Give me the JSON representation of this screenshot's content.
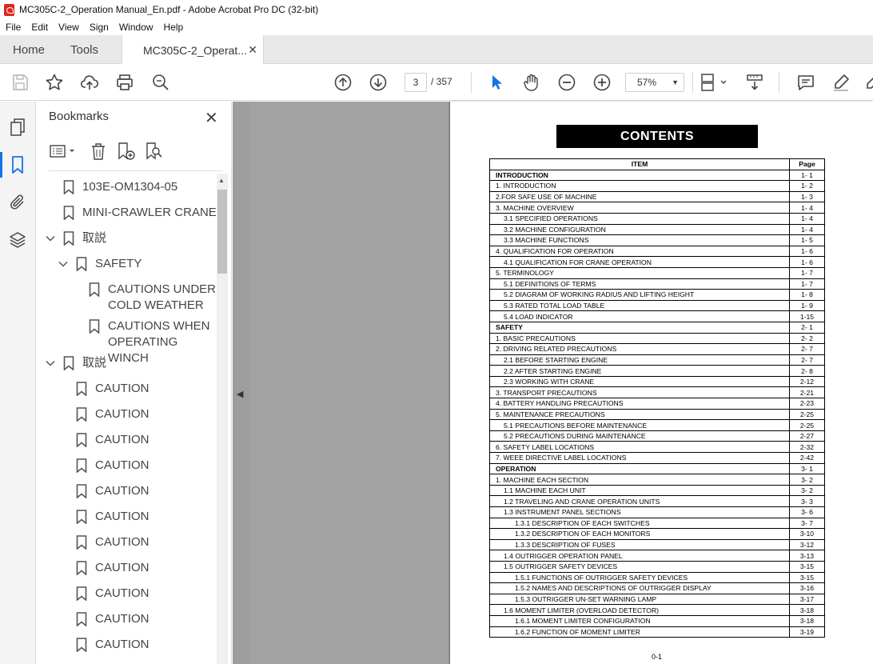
{
  "window": {
    "title": "MC305C-2_Operation Manual_En.pdf - Adobe Acrobat Pro DC (32-bit)"
  },
  "menu": [
    "File",
    "Edit",
    "View",
    "Sign",
    "Window",
    "Help"
  ],
  "tabs": {
    "home": "Home",
    "tools": "Tools",
    "doc": "MC305C-2_Operat..."
  },
  "toolbar": {
    "page_current": "3",
    "page_total": "/ 357",
    "zoom": "57%"
  },
  "bookmarks": {
    "header": "Bookmarks",
    "items": [
      {
        "label": "103E-OM1304-05"
      },
      {
        "label": "MINI-CRAWLER CRANE"
      },
      {
        "label": "取説"
      },
      {
        "label": "SAFETY"
      },
      {
        "label": "CAUTIONS UNDER COLD WEATHER"
      },
      {
        "label": "CAUTIONS WHEN OPERATING WINCH"
      },
      {
        "label": "取説"
      },
      {
        "label": "CAUTION"
      },
      {
        "label": "CAUTION"
      },
      {
        "label": "CAUTION"
      },
      {
        "label": "CAUTION"
      },
      {
        "label": "CAUTION"
      },
      {
        "label": "CAUTION"
      },
      {
        "label": "CAUTION"
      },
      {
        "label": "CAUTION"
      },
      {
        "label": "CAUTION"
      },
      {
        "label": "CAUTION"
      },
      {
        "label": "CAUTION"
      }
    ]
  },
  "document": {
    "banner": "CONTENTS",
    "col_item": "ITEM",
    "col_page": "Page",
    "footer": "0-1",
    "rows": [
      {
        "item": "INTRODUCTION",
        "page": "1- 1",
        "level": 0,
        "bold": true
      },
      {
        "item": "1. INTRODUCTION",
        "page": "1- 2",
        "level": 0
      },
      {
        "item": "2.FOR SAFE USE OF MACHINE",
        "page": "1- 3",
        "level": 0
      },
      {
        "item": "3. MACHINE OVERVIEW",
        "page": "1- 4",
        "level": 0
      },
      {
        "item": "3.1 SPECIFIED OPERATIONS",
        "page": "1- 4",
        "level": 1
      },
      {
        "item": "3.2 MACHINE CONFIGURATION",
        "page": "1- 4",
        "level": 1
      },
      {
        "item": "3.3 MACHINE FUNCTIONS",
        "page": "1- 5",
        "level": 1
      },
      {
        "item": "4. QUALIFICATION FOR OPERATION",
        "page": "1- 6",
        "level": 0
      },
      {
        "item": "4.1 QUALIFICATION FOR CRANE OPERATION",
        "page": "1- 6",
        "level": 1
      },
      {
        "item": "5. TERMINOLOGY",
        "page": "1- 7",
        "level": 0
      },
      {
        "item": "5.1 DEFINITIONS OF TERMS",
        "page": "1- 7",
        "level": 1
      },
      {
        "item": "5.2 DIAGRAM OF WORKING RADIUS AND LIFTING HEIGHT",
        "page": "1- 8",
        "level": 1
      },
      {
        "item": "5.3 RATED TOTAL LOAD TABLE",
        "page": "1- 9",
        "level": 1
      },
      {
        "item": "5.4 LOAD INDICATOR",
        "page": "1-15",
        "level": 1
      },
      {
        "item": "SAFETY",
        "page": "2- 1",
        "level": 0,
        "bold": true
      },
      {
        "item": "1. BASIC PRECAUTIONS",
        "page": "2- 2",
        "level": 0
      },
      {
        "item": "2. DRIVING RELATED PRECAUTIONS",
        "page": "2- 7",
        "level": 0
      },
      {
        "item": "2.1 BEFORE STARTING ENGINE",
        "page": "2- 7",
        "level": 1
      },
      {
        "item": "2.2 AFTER STARTING ENGINE",
        "page": "2- 8",
        "level": 1
      },
      {
        "item": "2.3 WORKING WITH CRANE",
        "page": "2-12",
        "level": 1
      },
      {
        "item": "3. TRANSPORT PRECAUTIONS",
        "page": "2-21",
        "level": 0
      },
      {
        "item": "4. BATTERY HANDLING PRECAUTIONS",
        "page": "2-23",
        "level": 0
      },
      {
        "item": "5. MAINTENANCE PRECAUTIONS",
        "page": "2-25",
        "level": 0
      },
      {
        "item": "5.1 PRECAUTIONS BEFORE MAINTENANCE",
        "page": "2-25",
        "level": 1
      },
      {
        "item": "5.2 PRECAUTIONS DURING MAINTENANCE",
        "page": "2-27",
        "level": 1
      },
      {
        "item": "6. SAFETY LABEL LOCATIONS",
        "page": "2-32",
        "level": 0
      },
      {
        "item": "7. WEEE DIRECTIVE LABEL LOCATIONS",
        "page": "2-42",
        "level": 0
      },
      {
        "item": "OPERATION",
        "page": "3- 1",
        "level": 0,
        "bold": true
      },
      {
        "item": "1. MACHINE EACH SECTION",
        "page": "3- 2",
        "level": 0
      },
      {
        "item": "1.1 MACHINE EACH UNIT",
        "page": "3- 2",
        "level": 1
      },
      {
        "item": "1.2 TRAVELING AND CRANE OPERATION UNITS",
        "page": "3- 3",
        "level": 1
      },
      {
        "item": "1.3 INSTRUMENT PANEL SECTIONS",
        "page": "3- 6",
        "level": 1
      },
      {
        "item": "1.3.1 DESCRIPTION OF EACH SWITCHES",
        "page": "3- 7",
        "level": 2
      },
      {
        "item": "1.3.2 DESCRIPTION  OF EACH MONITORS",
        "page": "3-10",
        "level": 2
      },
      {
        "item": "1.3.3 DESCRIPTION OF FUSES",
        "page": "3-12",
        "level": 2
      },
      {
        "item": "1.4 OUTRIGGER OPERATION PANEL",
        "page": "3-13",
        "level": 1
      },
      {
        "item": "1.5 OUTRIGGER SAFETY DEVICES",
        "page": "3-15",
        "level": 1
      },
      {
        "item": "1.5.1 FUNCTIONS OF OUTRIGGER SAFETY DEVICES",
        "page": "3-15",
        "level": 2
      },
      {
        "item": "1.5.2 NAMES AND DESCRIPTIONS OF OUTRIGGER DISPLAY",
        "page": "3-16",
        "level": 2
      },
      {
        "item": "1.5.3 OUTRIGGER UN-SET WARNING LAMP",
        "page": "3-17",
        "level": 2
      },
      {
        "item": "1.6 MOMENT LIMITER (OVERLOAD DETECTOR)",
        "page": "3-18",
        "level": 1
      },
      {
        "item": "1.6.1 MOMENT LIMITER CONFIGURATION",
        "page": "3-18",
        "level": 2
      },
      {
        "item": "1.6.2 FUNCTION OF MOMENT LIMITER",
        "page": "3-19",
        "level": 2
      }
    ]
  },
  "colors": {
    "accent": "#1473e6",
    "canvas": "#9d9d9d",
    "brand": "#e0251b"
  }
}
